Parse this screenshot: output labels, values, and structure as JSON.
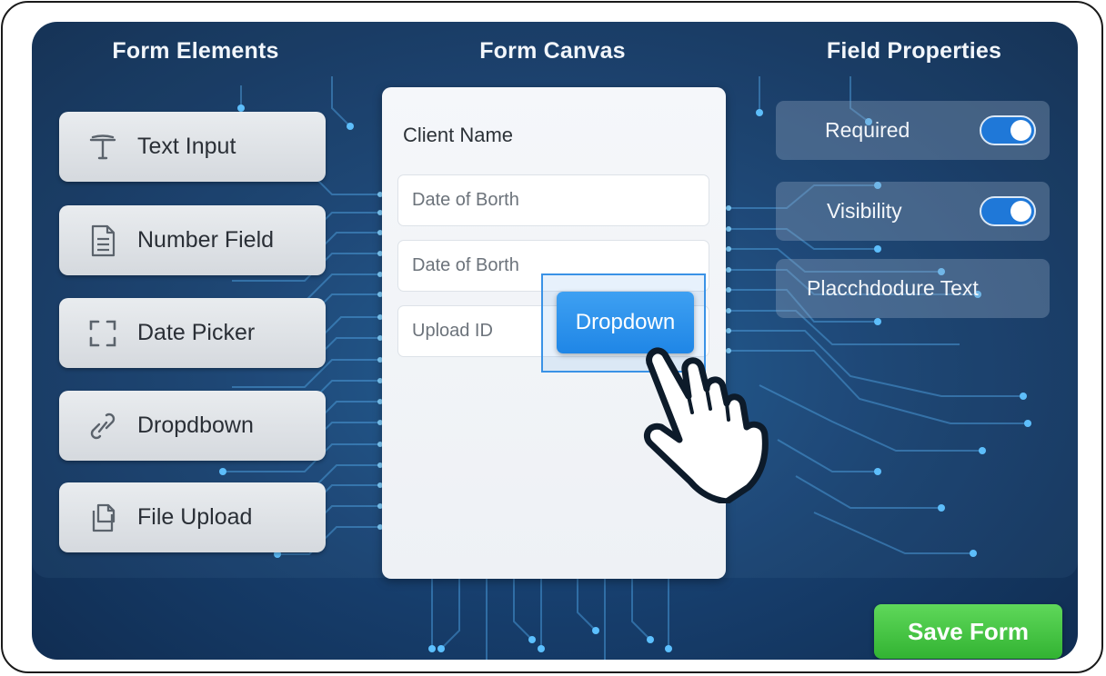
{
  "columns": {
    "elements_title": "Form Elements",
    "canvas_title": "Form Canvas",
    "properties_title": "Field Properties"
  },
  "elements": [
    {
      "label": "Text Input",
      "icon": "text-input-icon"
    },
    {
      "label": "Number Field",
      "icon": "document-icon"
    },
    {
      "label": "Date Picker",
      "icon": "date-picker-icon"
    },
    {
      "label": "Dropdbown",
      "icon": "link-icon"
    },
    {
      "label": "File Upload",
      "icon": "file-upload-icon"
    }
  ],
  "canvas": {
    "label": "Client Name",
    "fields": [
      {
        "placeholder": "Date of Borth"
      },
      {
        "placeholder": "Date of Borth"
      },
      {
        "placeholder": "Upload ID"
      }
    ],
    "dragging_chip": "Dropdown"
  },
  "properties": {
    "required_label": "Required",
    "required_on": true,
    "visibility_label": "Visibility",
    "visibility_on": true,
    "placeholder_label": "Placchdodure Text"
  },
  "save_button": "Save Form",
  "colors": {
    "background": "#173f6e",
    "accent": "#1f86e6",
    "save": "#32b332",
    "circuit": "#4fb0f0"
  }
}
